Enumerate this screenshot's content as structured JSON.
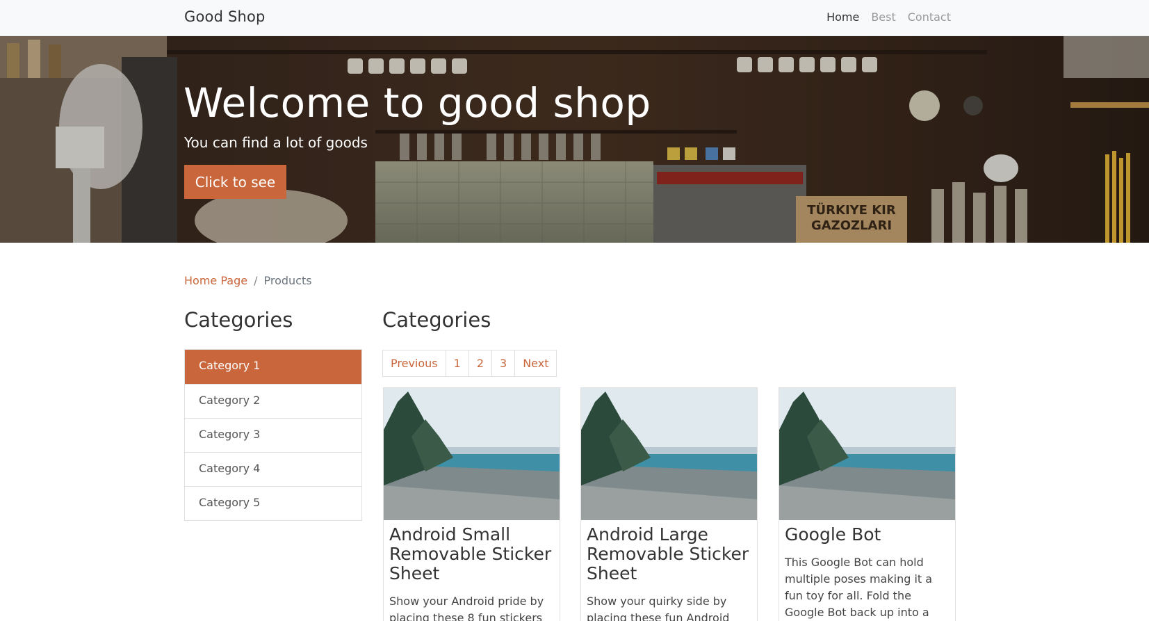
{
  "navbar": {
    "brand": "Good Shop",
    "links": [
      {
        "label": "Home",
        "active": true
      },
      {
        "label": "Best",
        "active": false
      },
      {
        "label": "Contact",
        "active": false
      }
    ]
  },
  "hero": {
    "title": "Welcome to good shop",
    "subtitle": "You can find a lot of goods",
    "button_label": "Click to see",
    "sign_text": [
      "TÜRKIYE KIR",
      "GAZOZLARI"
    ]
  },
  "breadcrumb": {
    "home": "Home Page",
    "separator": "/",
    "current": "Products"
  },
  "sidebar": {
    "heading": "Categories",
    "items": [
      {
        "label": "Category 1",
        "active": true
      },
      {
        "label": "Category 2",
        "active": false
      },
      {
        "label": "Category 3",
        "active": false
      },
      {
        "label": "Category 4",
        "active": false
      },
      {
        "label": "Category 5",
        "active": false
      }
    ]
  },
  "main": {
    "heading": "Categories",
    "pagination": [
      "Previous",
      "1",
      "2",
      "3",
      "Next"
    ],
    "products": [
      {
        "title": "Android Small Removable Sticker Sheet",
        "description": "Show your Android pride by placing these 8 fun stickers"
      },
      {
        "title": "Android Large Removable Sticker Sheet",
        "description": "Show your quirky side by placing these fun Android"
      },
      {
        "title": "Google Bot",
        "description": "This Google Bot can hold multiple poses making it a fun toy for all. Fold the Google Bot back up into a"
      }
    ]
  },
  "colors": {
    "accent": "#c9663b",
    "navbar_bg": "#f8f9fa",
    "border": "#dfdfdf"
  }
}
